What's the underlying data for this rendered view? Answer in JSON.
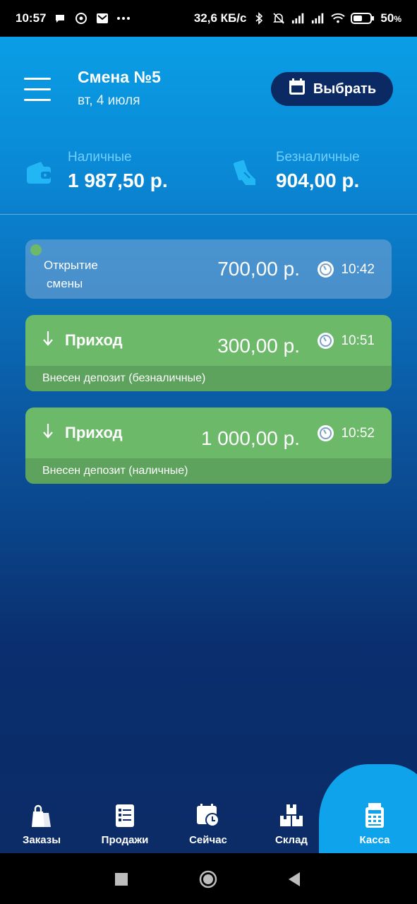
{
  "status_bar": {
    "time": "10:57",
    "network_speed": "32,6 КБ/с",
    "battery": "50",
    "battery_unit": "%"
  },
  "header": {
    "shift_title": "Смена №5",
    "shift_date": "вт, 4 июля",
    "select_label": "Выбрать"
  },
  "balances": {
    "cash_label": "Наличные",
    "cash_value": "1 987,50 р.",
    "cashless_label": "Безналичные",
    "cashless_value": "904,00 р."
  },
  "operations": [
    {
      "type": "open",
      "label_line1": "Открытие",
      "label_line2": "смены",
      "amount": "700,00 р.",
      "time": "10:42"
    },
    {
      "type": "income",
      "title": "Приход",
      "amount": "300,00 р.",
      "time": "10:51",
      "note": "Внесен депозит (безналичные)"
    },
    {
      "type": "income",
      "title": "Приход",
      "amount": "1 000,00 р.",
      "time": "10:52",
      "note": "Внесен депозит (наличные)"
    }
  ],
  "nav": {
    "orders": "Заказы",
    "sales": "Продажи",
    "now": "Сейчас",
    "warehouse": "Склад",
    "cashbox": "Касса"
  },
  "colors": {
    "accent": "#0ea3ea",
    "income_card": "#6cba69",
    "select_button": "#0b2a63"
  }
}
